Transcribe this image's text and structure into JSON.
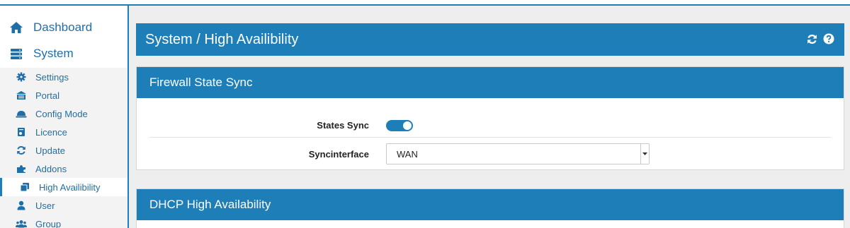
{
  "sidebar": {
    "main": [
      {
        "label": "Dashboard",
        "icon": "home-icon"
      },
      {
        "label": "System",
        "icon": "server-icon"
      }
    ],
    "items": [
      {
        "label": "Settings",
        "icon": "cog-icon"
      },
      {
        "label": "Portal",
        "icon": "portal-icon"
      },
      {
        "label": "Config Mode",
        "icon": "config-mode-icon"
      },
      {
        "label": "Licence",
        "icon": "licence-icon"
      },
      {
        "label": "Update",
        "icon": "refresh-icon"
      },
      {
        "label": "Addons",
        "icon": "puzzle-icon"
      },
      {
        "label": "High Availibility",
        "icon": "copy-icon",
        "active": true
      },
      {
        "label": "User",
        "icon": "user-icon"
      },
      {
        "label": "Group",
        "icon": "group-icon"
      }
    ]
  },
  "header": {
    "title": "System / High Availibility"
  },
  "firewall_state_sync": {
    "title": "Firewall State Sync",
    "states_sync_label": "States Sync",
    "states_sync_on": true,
    "syncinterface_label": "Syncinterface",
    "syncinterface_value": "WAN"
  },
  "dhcp_panel": {
    "title": "DHCP High Availability"
  },
  "colors": {
    "accent": "#1e7fb8",
    "link": "#1e6fa8"
  }
}
